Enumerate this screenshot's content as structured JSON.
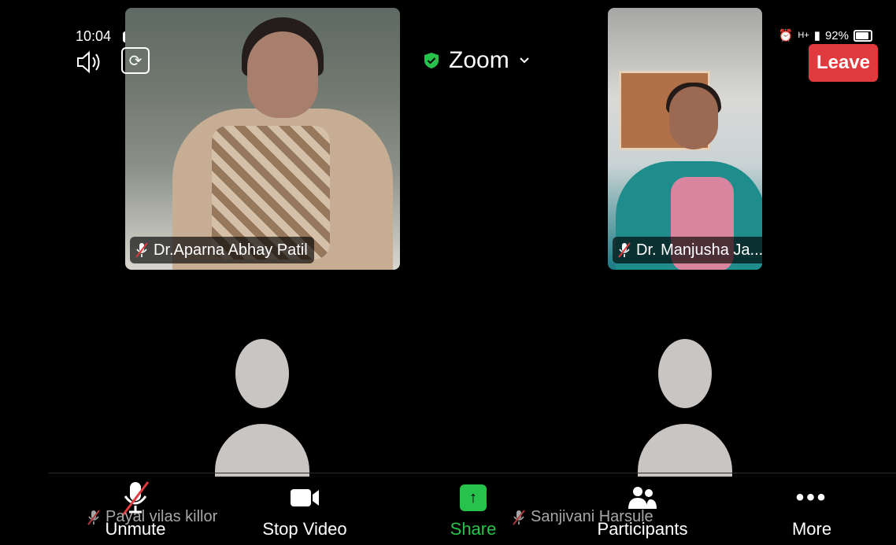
{
  "status_bar": {
    "time": "10:04",
    "network": "H+",
    "battery": "92%"
  },
  "top_bar": {
    "meeting_title": "Zoom",
    "leave_label": "Leave",
    "security_color": "#27c24c",
    "leave_color": "#e0393e"
  },
  "participants": {
    "video_1_name": "Dr.Aparna Abhay Patil",
    "video_2_name": "Dr. Manjusha Ja...",
    "avatar_1_name": "Payal vilas killor",
    "avatar_2_name": "Sanjivani Harsule"
  },
  "toolbar": {
    "unmute_label": "Unmute",
    "stop_video_label": "Stop Video",
    "share_label": "Share",
    "participants_label": "Participants",
    "more_label": "More",
    "more_glyph": "•••",
    "share_glyph": "↑",
    "share_color": "#27c24c"
  },
  "icons": {
    "camera_switch_glyph": "⟳"
  }
}
